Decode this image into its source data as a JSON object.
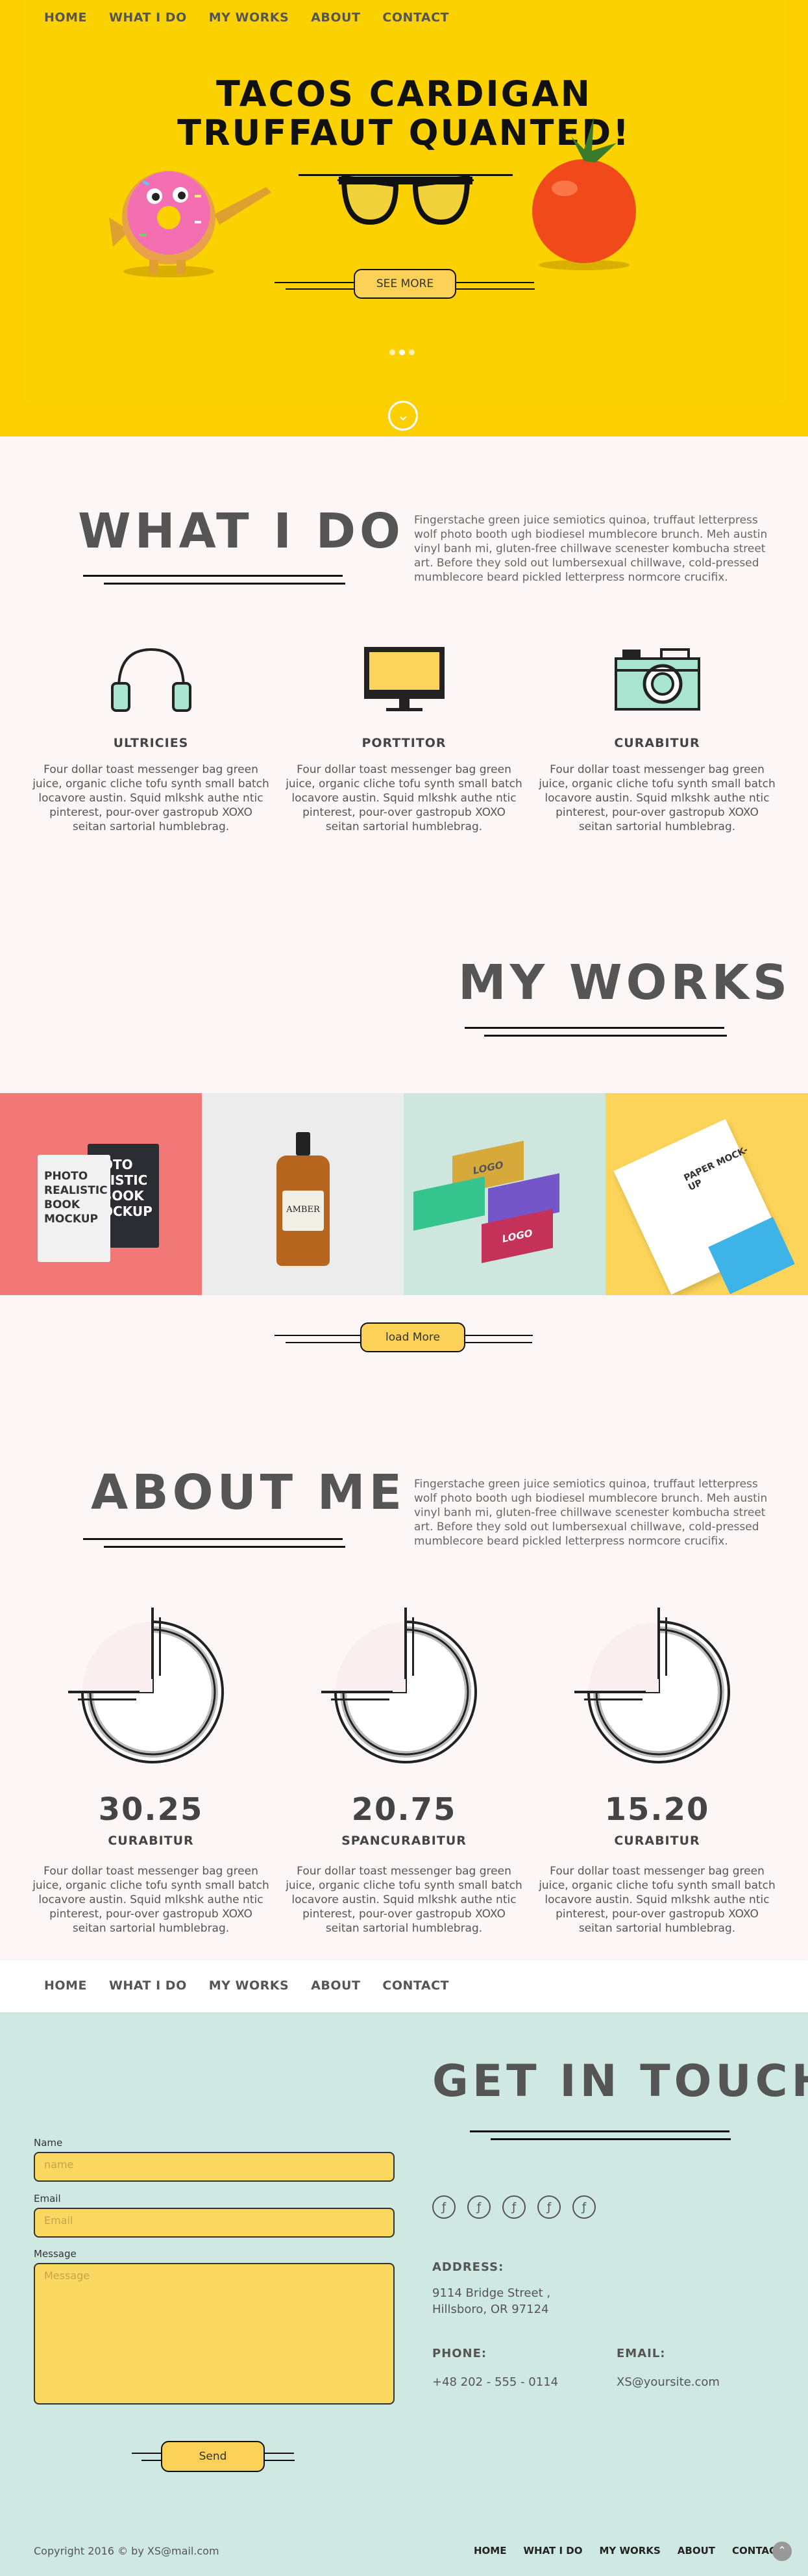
{
  "nav": {
    "items": [
      "HOME",
      "WHAT I DO",
      "MY WORKS",
      "ABOUT",
      "CONTACT"
    ]
  },
  "hero": {
    "title_line1": "TACOS CARDIGAN",
    "title_line2": "TRUFFAUT QUANTED!",
    "button": "SEE MORE",
    "colors": {
      "background": "#fcd000",
      "donut": "#f36fb1",
      "tomato": "#f04a1b"
    }
  },
  "what_i_do": {
    "heading": "WHAT I DO",
    "intro": "Fingerstache green juice semiotics quinoa, truffaut letterpress wolf photo booth ugh biodiesel mumblecore brunch. Meh austin vinyl banh mi, gluten-free chillwave scenester kombucha street art. Before they sold out lumbersexual chillwave, cold-pressed mumblecore beard pickled letterpress normcore crucifix.",
    "services": [
      {
        "icon": "headphones-icon",
        "title": "ULTRICIES",
        "text": "Four dollar toast messenger bag green juice, organic cliche tofu synth small batch locavore austin. Squid mlkshk authe ntic pinterest, pour-over gastropub XOXO seitan sartorial humblebrag."
      },
      {
        "icon": "monitor-icon",
        "title": "PORTTITOR",
        "text": "Four dollar toast messenger bag green juice, organic cliche tofu synth small batch locavore austin. Squid mlkshk authe ntic pinterest, pour-over gastropub XOXO seitan sartorial humblebrag."
      },
      {
        "icon": "camera-icon",
        "title": "CURABITUR",
        "text": "Four dollar toast messenger bag green juice, organic cliche tofu synth small batch locavore austin. Squid mlkshk authe ntic pinterest, pour-over gastropub XOXO seitan sartorial humblebrag."
      }
    ]
  },
  "my_works": {
    "heading": "MY WORKS",
    "items": [
      {
        "name": "book-mockup",
        "text": "PHOTO REALISTIC BOOK MOCKUP",
        "bg": "#f27777"
      },
      {
        "name": "bottle-mockup",
        "text": "AMBER",
        "bg": "#ececec"
      },
      {
        "name": "business-cards",
        "text": "LOGO",
        "bg": "#cde6de"
      },
      {
        "name": "paper-mockup",
        "text": "PAPER MOCK-UP",
        "bg": "#fcd45a"
      }
    ],
    "load_more": "load More"
  },
  "about": {
    "heading": "ABOUT ME",
    "intro": "Fingerstache green juice semiotics quinoa, truffaut letterpress wolf photo booth ugh biodiesel mumblecore brunch. Meh austin vinyl banh mi, gluten-free chillwave scenester kombucha street art. Before they sold out lumbersexual chillwave, cold-pressed mumblecore beard pickled letterpress normcore crucifix.",
    "stats": [
      {
        "value": "30.25",
        "label": "CURABITUR",
        "text": "Four dollar toast messenger bag green juice, organic cliche tofu synth small batch locavore austin. Squid mlkshk authe ntic pinterest, pour-over gastropub XOXO seitan sartorial humblebrag."
      },
      {
        "value": "20.75",
        "label": "SPANCURABITUR",
        "text": "Four dollar toast messenger bag green juice, organic cliche tofu synth small batch locavore austin. Squid mlkshk authe ntic pinterest, pour-over gastropub XOXO seitan sartorial humblebrag."
      },
      {
        "value": "15.20",
        "label": "CURABITUR",
        "text": "Four dollar toast messenger bag green juice, organic cliche tofu synth small batch locavore austin. Squid mlkshk authe ntic pinterest, pour-over gastropub XOXO seitan sartorial humblebrag."
      }
    ]
  },
  "contact": {
    "heading": "GET IN TOUCH",
    "form": {
      "name_label": "Name",
      "name_placeholder": "name",
      "email_label": "Email",
      "email_placeholder": "Email",
      "message_label": "Message",
      "message_placeholder": "Message",
      "send": "Send"
    },
    "social_icons": [
      "social-icon-1",
      "social-icon-2",
      "social-icon-3",
      "social-icon-4",
      "social-icon-5"
    ],
    "address_label": "ADDRESS:",
    "address_line1": "9114 Bridge Street ,",
    "address_line2": "Hillsboro, OR 97124",
    "phone_label": "PHONE:",
    "phone": "+48 202 - 555 - 0114",
    "email_label": "EMAIL:",
    "email": "XS@yoursite.com",
    "bg": "#cfe8e1"
  },
  "footer": {
    "copyright": "Copyright 2016 © by XS@mail.com",
    "nav": [
      "HOME",
      "WHAT I DO",
      "MY WORKS",
      "ABOUT",
      "CONTACT"
    ]
  }
}
